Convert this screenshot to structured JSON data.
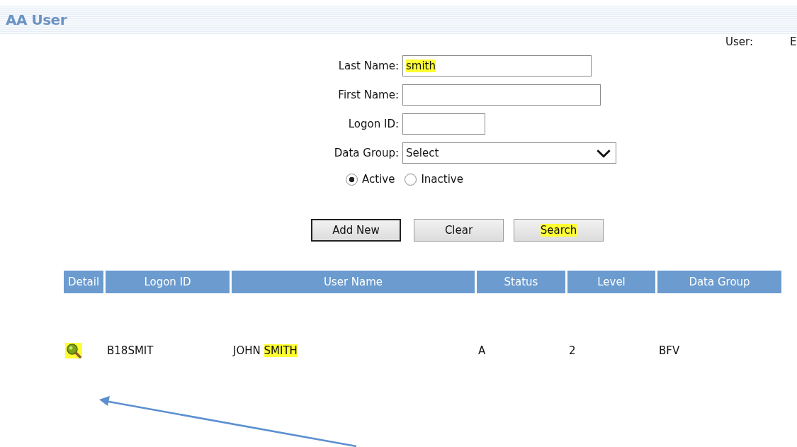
{
  "header": {
    "title": "AA User"
  },
  "user_info": {
    "label": "User:",
    "value": "E"
  },
  "form": {
    "fields": [
      {
        "kind": "text",
        "label": "Last Name:",
        "value": "smith",
        "highlighted": true
      },
      {
        "kind": "text",
        "label": "First Name:"
      },
      {
        "kind": "text",
        "label": "Logon ID:"
      },
      {
        "kind": "select",
        "label": "Data Group:",
        "value": "Select",
        "highlighted": false
      }
    ],
    "radios": [
      {
        "label": "Active",
        "selected": true
      },
      {
        "label": "Inactive",
        "selected": false
      }
    ],
    "buttons": [
      {
        "label": "Add New",
        "default": true,
        "highlighted": false
      },
      {
        "label": "Clear",
        "default": false,
        "highlighted": false
      },
      {
        "label": "Search",
        "default": false,
        "highlighted": true
      }
    ]
  },
  "table": {
    "columns": [
      "Detail",
      "Logon ID",
      "User Name",
      "Status",
      "Level",
      "Data Group"
    ],
    "rows": [
      {
        "detail_highlighted": true,
        "logon_id": "B18SMIT",
        "user_name": [
          {
            "text": "JOHN ",
            "highlighted": false
          },
          {
            "text": "SMITH",
            "highlighted": true
          }
        ],
        "status": "A",
        "level": "2",
        "data_group": "BFV"
      }
    ]
  },
  "annotation": {
    "kind": "arrow"
  }
}
